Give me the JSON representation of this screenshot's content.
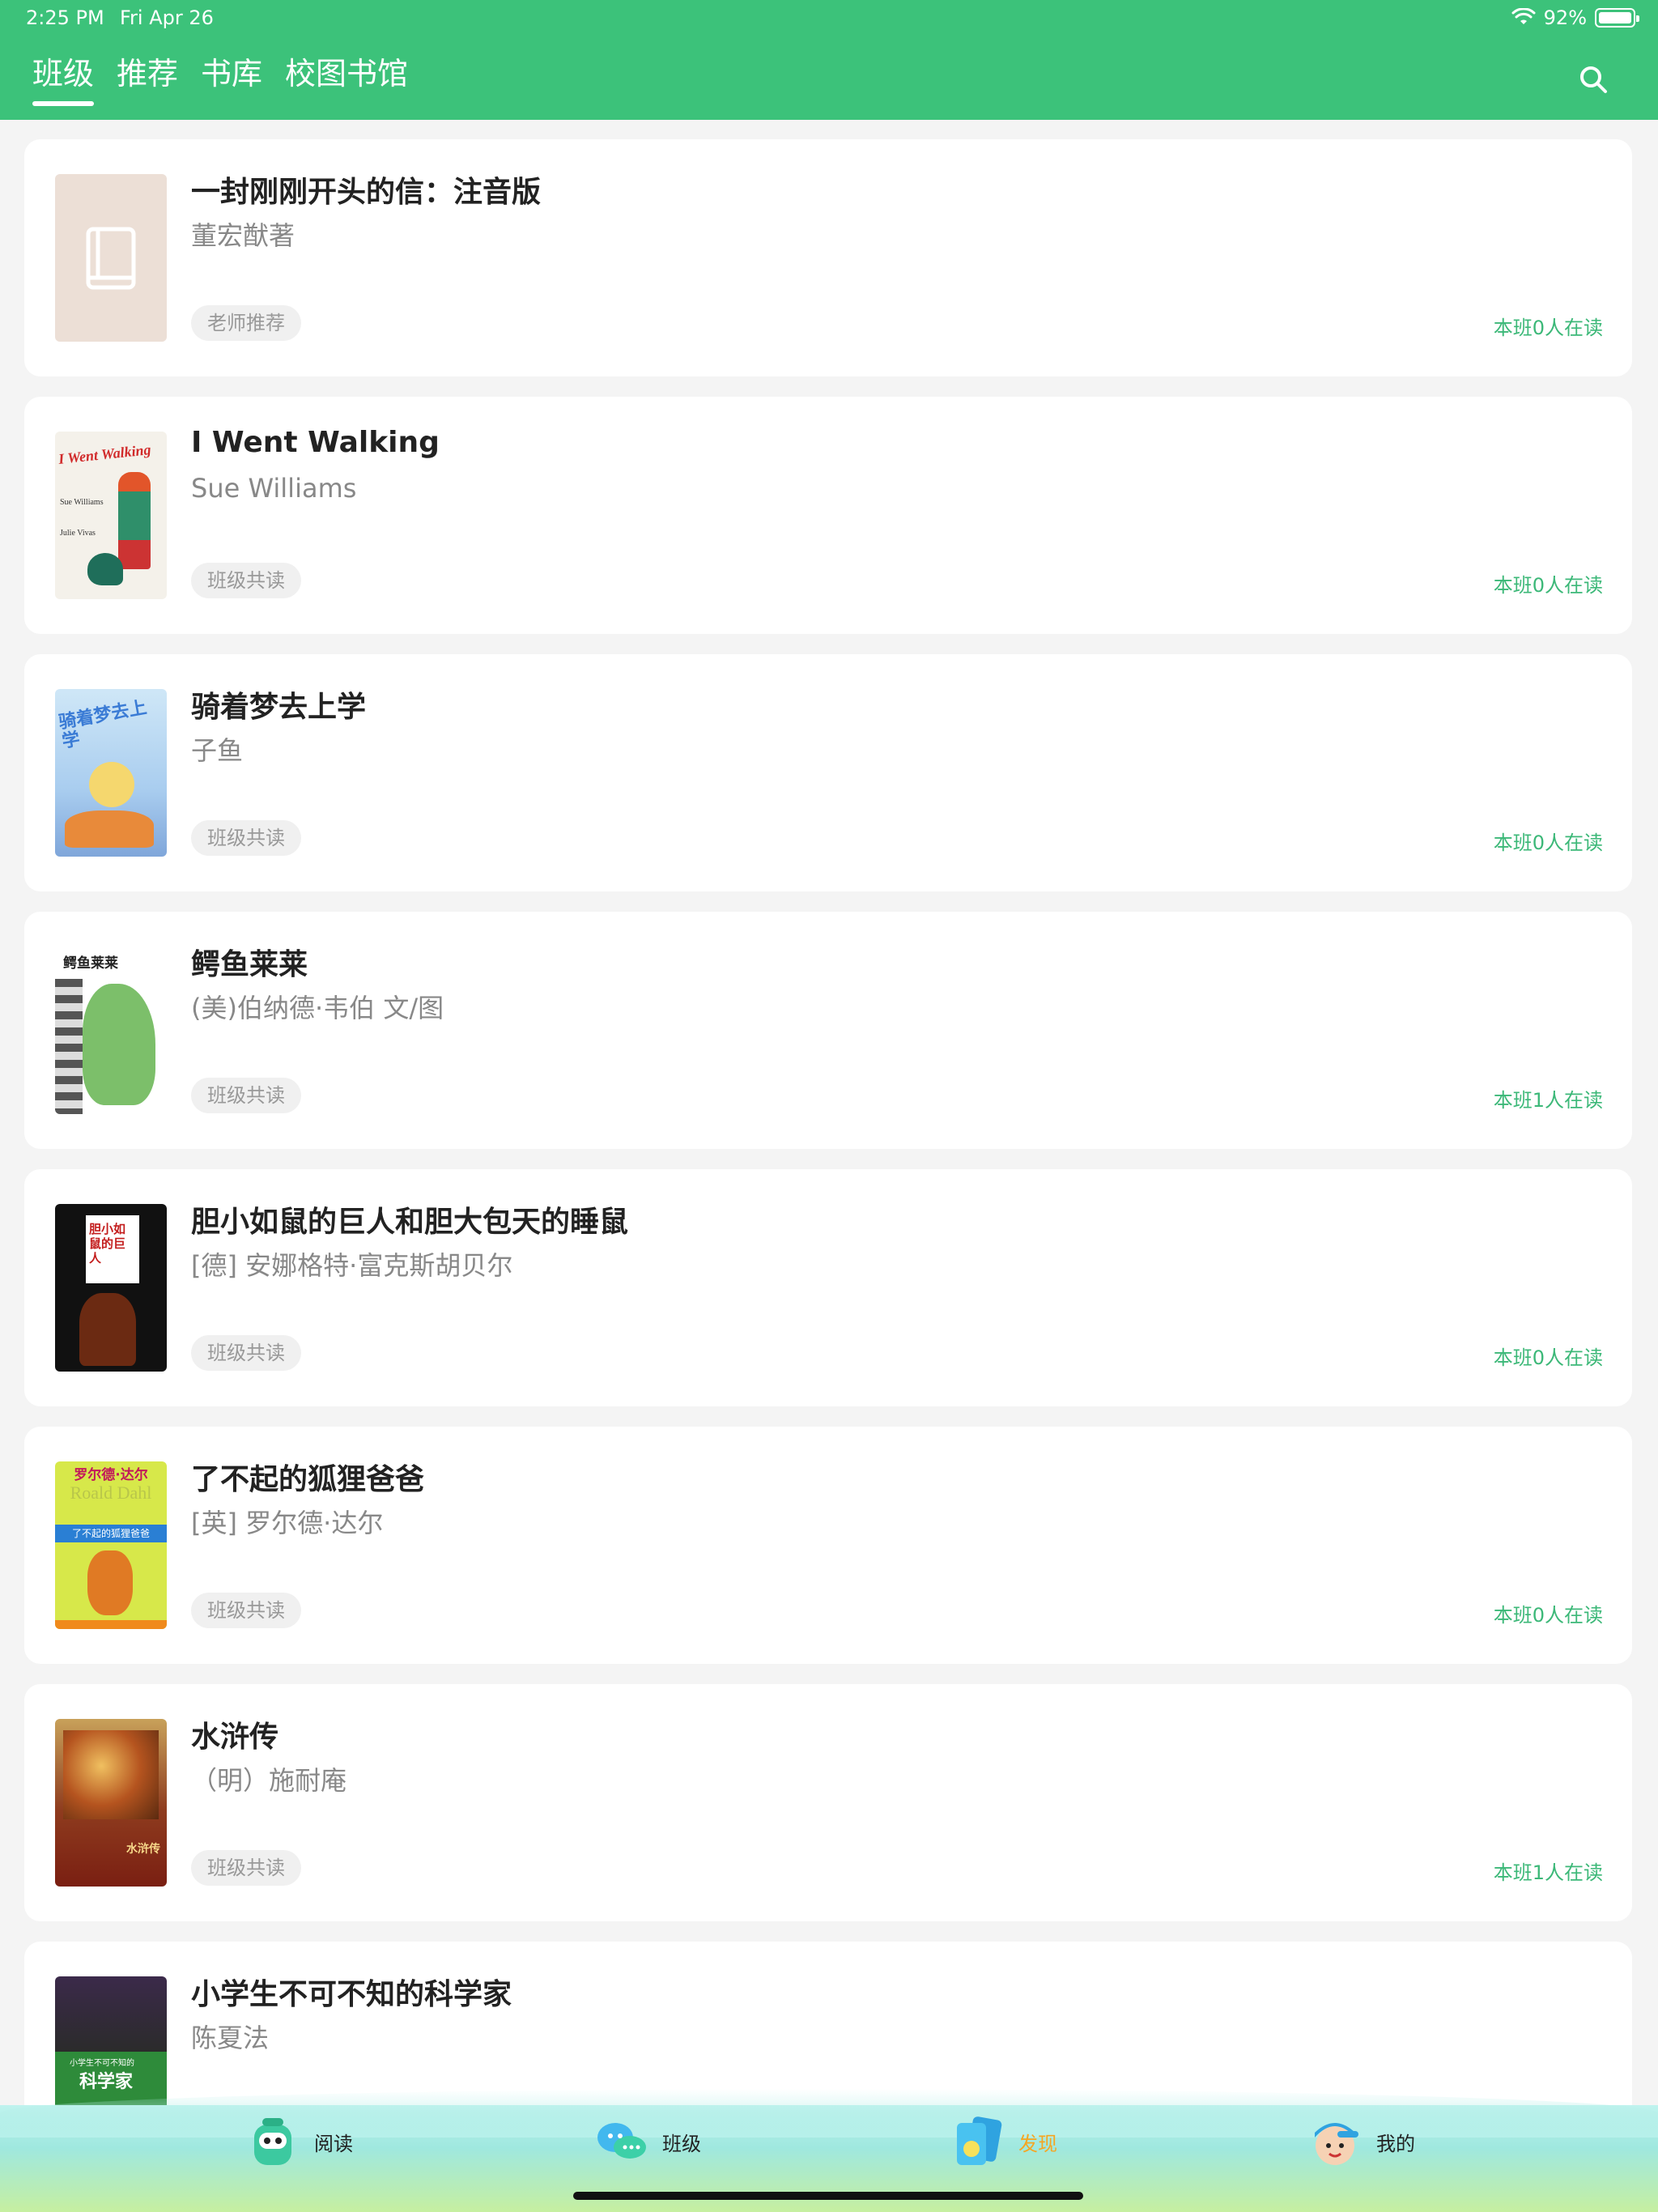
{
  "status_bar": {
    "time": "2:25 PM",
    "date": "Fri Apr 26",
    "battery": "92%",
    "battery_level": 0.92
  },
  "header": {
    "tabs": [
      {
        "label": "班级",
        "active": true
      },
      {
        "label": "推荐",
        "active": false
      },
      {
        "label": "书库",
        "active": false
      },
      {
        "label": "校图书馆",
        "active": false
      }
    ],
    "search_icon": "search-icon"
  },
  "books": [
    {
      "title": "一封刚刚开头的信：注音版",
      "author": "董宏猷著",
      "tag": "老师推荐",
      "readers": "本班0人在读"
    },
    {
      "title": "I Went Walking",
      "author": "Sue Williams",
      "tag": "班级共读",
      "readers": "本班0人在读",
      "cover_text": "I Went Walking",
      "cover_sub1": "Sue Williams",
      "cover_sub2": "Julie Vivas"
    },
    {
      "title": "骑着梦去上学",
      "author": "子鱼",
      "tag": "班级共读",
      "readers": "本班0人在读",
      "cover_text": "骑着梦去上学"
    },
    {
      "title": "鳄鱼莱莱",
      "author": "(美)伯纳德·韦伯 文/图",
      "tag": "班级共读",
      "readers": "本班1人在读",
      "cover_text": "鳄鱼莱莱"
    },
    {
      "title": "胆小如鼠的巨人和胆大包天的睡鼠",
      "author": "[德] 安娜格特·富克斯胡贝尔",
      "tag": "班级共读",
      "readers": "本班0人在读",
      "cover_text": "胆小如鼠的巨人"
    },
    {
      "title": "了不起的狐狸爸爸",
      "author": "[英] 罗尔德·达尔",
      "tag": "班级共读",
      "readers": "本班0人在读",
      "cover_text": "罗尔德·达尔",
      "cover_sub1": "Roald Dahl",
      "cover_sub2": "了不起的狐狸爸爸"
    },
    {
      "title": "水浒传",
      "author": "（明）施耐庵",
      "tag": "班级共读",
      "readers": "本班1人在读",
      "cover_text": "水浒传"
    },
    {
      "title": "小学生不可不知的科学家",
      "author": "陈夏法",
      "tag": "",
      "readers": "",
      "cover_text": "科学家",
      "cover_sub1": "小学生不可不知的"
    }
  ],
  "bottom_nav": [
    {
      "label": "阅读",
      "icon": "robot-backpack-icon",
      "active": false
    },
    {
      "label": "班级",
      "icon": "chat-bubbles-icon",
      "active": false
    },
    {
      "label": "发现",
      "icon": "discover-cards-icon",
      "active": true
    },
    {
      "label": "我的",
      "icon": "boy-avatar-icon",
      "active": false
    }
  ],
  "colors": {
    "brand": "#3cc27a",
    "readers": "#3cb878",
    "active_nav": "#f5a623"
  }
}
